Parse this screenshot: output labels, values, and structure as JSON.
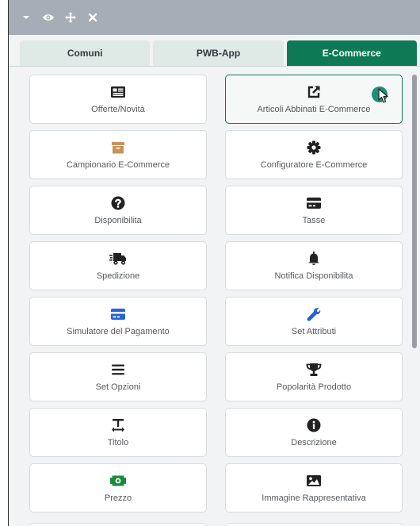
{
  "toolbar": {
    "icons": [
      "chevron-down-icon",
      "eye-icon",
      "move-icon",
      "close-icon"
    ]
  },
  "tabs": [
    {
      "label": "Comuni",
      "active": false
    },
    {
      "label": "PWB-App",
      "active": false
    },
    {
      "label": "E-Commerce",
      "active": true
    }
  ],
  "colors": {
    "accent": "#0d7a55",
    "titlebar": "#a7adb6",
    "box_brown": "#c8935a",
    "card_blue": "#2563d9",
    "money_green": "#1a8a3a"
  },
  "items": [
    {
      "label": "Offerte/Novità",
      "icon": "newspaper-icon"
    },
    {
      "label": "Articoli Abbinati E-Commerce",
      "icon": "external-link-icon"
    },
    {
      "label": "Campionario E-Commerce",
      "icon": "archive-box-icon"
    },
    {
      "label": "Configuratore E-Commerce",
      "icon": "cog-icon"
    },
    {
      "label": "Disponibilita",
      "icon": "question-circle-icon"
    },
    {
      "label": "Tasse",
      "icon": "credit-card-icon"
    },
    {
      "label": "Spedizione",
      "icon": "shipping-truck-icon"
    },
    {
      "label": "Notifica Disponibilita",
      "icon": "bell-icon"
    },
    {
      "label": "Simulatore del Pagamento",
      "icon": "credit-card-blue-icon"
    },
    {
      "label": "Set Attributi",
      "icon": "wrench-icon"
    },
    {
      "label": "Set Opzioni",
      "icon": "bars-icon"
    },
    {
      "label": "Popolarità Prodotto",
      "icon": "trophy-icon"
    },
    {
      "label": "Titolo",
      "icon": "text-height-icon"
    },
    {
      "label": "Descrizione",
      "icon": "info-circle-icon"
    },
    {
      "label": "Prezzo",
      "icon": "money-bill-icon"
    },
    {
      "label": "Immagine Rappresentativa",
      "icon": "image-icon"
    }
  ]
}
